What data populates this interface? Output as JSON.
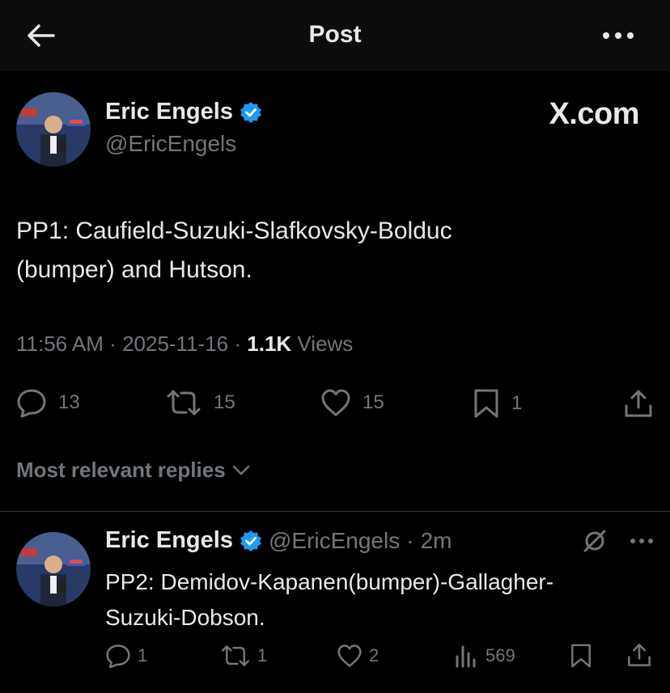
{
  "header": {
    "title": "Post",
    "back_icon": "arrow-left-icon",
    "more_icon": "more-horizontal-icon"
  },
  "post": {
    "author_name": "Eric Engels",
    "author_handle": "@EricEngels",
    "brand": "X.com",
    "text_line1": "PP1: Caufield-Suzuki-Slafkovsky-Bolduc",
    "text_line2": "(bumper) and Hutson.",
    "time": "11:56 AM",
    "date": "2025-11-16",
    "views_count": "1.1K",
    "views_label": "Views",
    "replies": "13",
    "reposts": "15",
    "likes": "15",
    "bookmarks": "1",
    "verified_color": "#1d9bf0"
  },
  "sort": {
    "label": "Most relevant replies"
  },
  "reply": {
    "author_name": "Eric Engels",
    "author_handle": "@EricEngels",
    "time_ago": "2m",
    "text_line1": "PP2: Demidov-Kapanen(bumper)-Gallagher-",
    "text_line2": "Suzuki-Dobson.",
    "replies": "1",
    "reposts": "1",
    "likes": "2",
    "views": "569"
  },
  "colors": {
    "background": "#000000",
    "text": "#e7e9ea",
    "muted": "#71767b",
    "divider": "#2f3336"
  }
}
